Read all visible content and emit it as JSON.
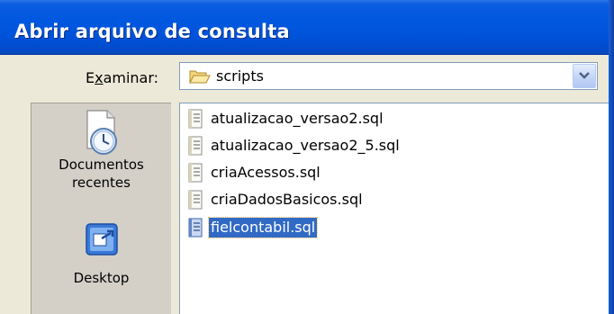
{
  "dialog": {
    "title": "Abrir arquivo de consulta"
  },
  "lookin": {
    "label": "Examinar:",
    "access_key": "x",
    "folder": "scripts",
    "folder_icon": "folder-open-icon",
    "dropdown_icon": "chevron-down-icon"
  },
  "places": [
    {
      "label_line1": "Documentos",
      "label_line2": "recentes",
      "icon": "recent-documents-icon"
    },
    {
      "label_line1": "Desktop",
      "label_line2": "",
      "icon": "desktop-icon"
    }
  ],
  "files": [
    {
      "name": "atualizacao_versao2.sql",
      "icon": "sql-file-icon",
      "selected": false
    },
    {
      "name": "atualizacao_versao2_5.sql",
      "icon": "sql-file-icon",
      "selected": false
    },
    {
      "name": "criaAcessos.sql",
      "icon": "sql-file-icon",
      "selected": false
    },
    {
      "name": "criaDadosBasicos.sql",
      "icon": "sql-file-icon",
      "selected": false
    },
    {
      "name": "fielcontabil.sql",
      "icon": "sql-file-icon",
      "selected": true
    }
  ],
  "colors": {
    "titlebar": "#0058e0",
    "selection": "#316ac5",
    "dialog_background": "#ece9d8"
  }
}
